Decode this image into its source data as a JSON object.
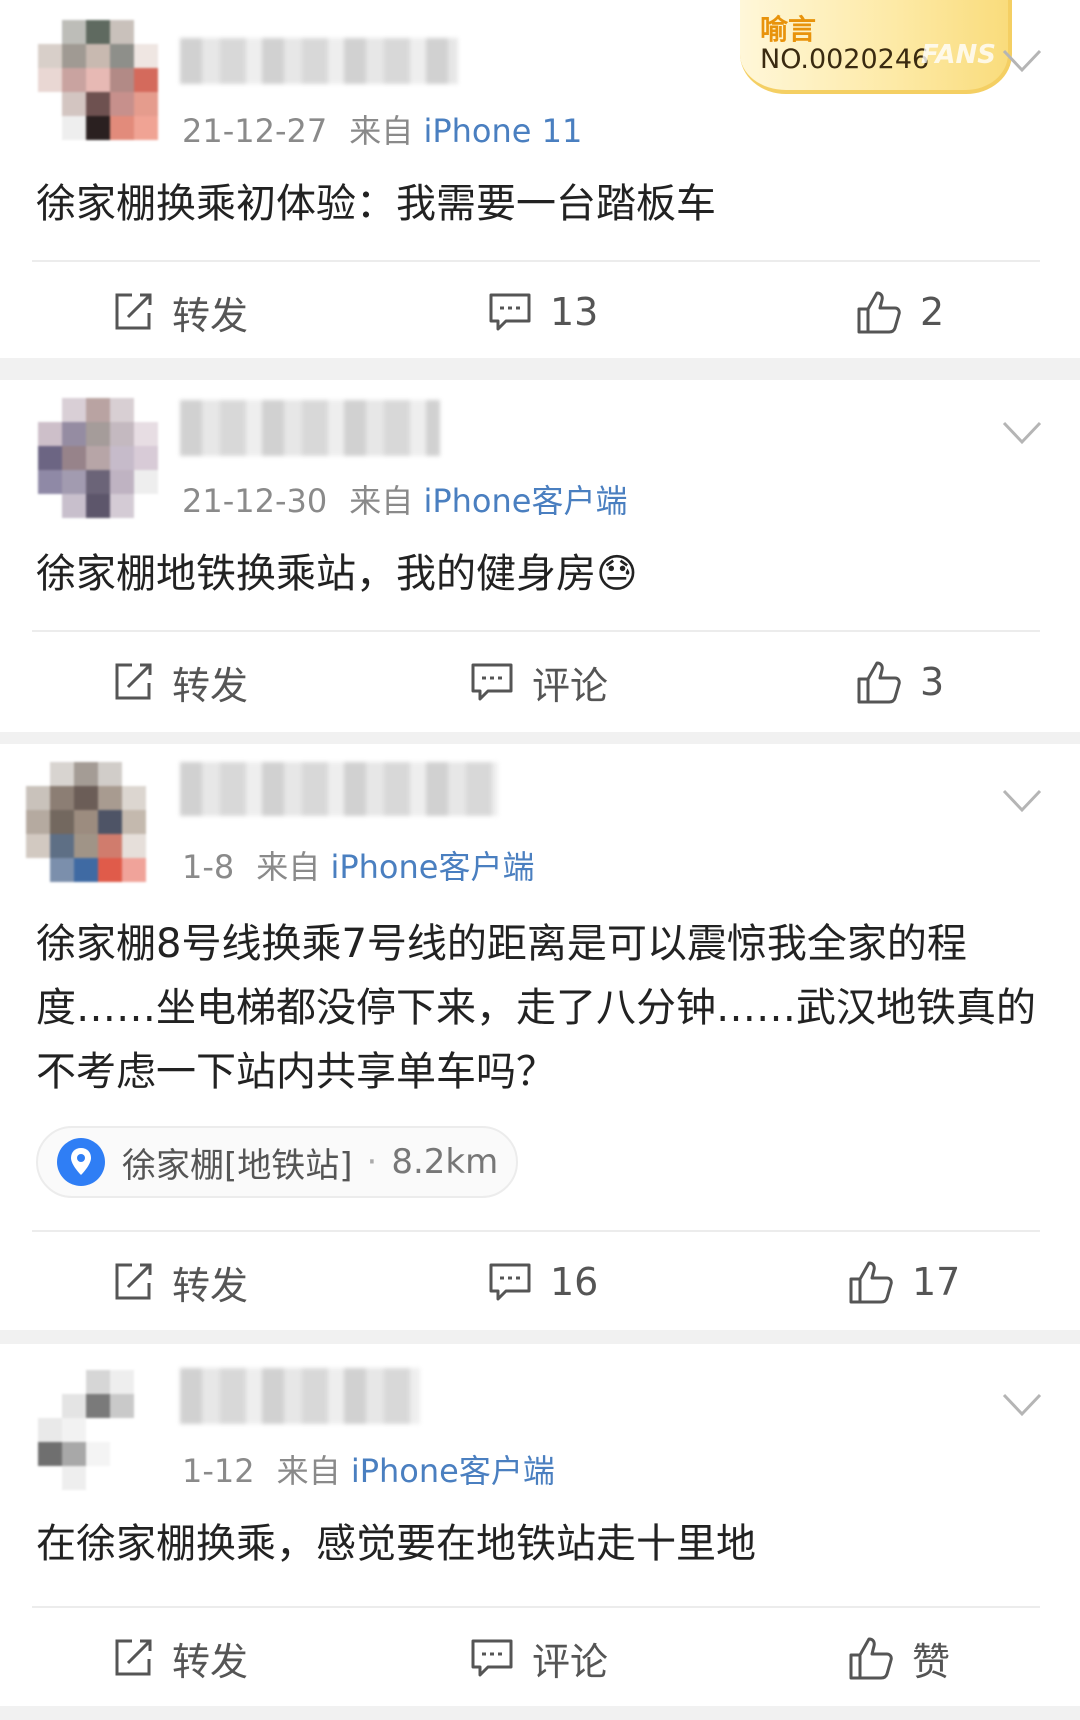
{
  "posts": [
    {
      "date": "21-12-27",
      "source_prefix": "来自",
      "source": "iPhone 11",
      "text": "徐家棚换乘初体验：我需要一台踏板车",
      "badge": {
        "title": "喻言",
        "number": "NO.0020246",
        "fans": "FANS"
      },
      "actions": {
        "repost": "转发",
        "comment": "13",
        "like": "2"
      }
    },
    {
      "date": "21-12-30",
      "source_prefix": "来自",
      "source": "iPhone客户端",
      "text": "徐家棚地铁换乘站，我的健身房😓",
      "actions": {
        "repost": "转发",
        "comment": "评论",
        "like": "3"
      }
    },
    {
      "date": "1-8",
      "source_prefix": "来自",
      "source": "iPhone客户端",
      "text": "徐家棚8号线换乘7号线的距离是可以震惊我全家的程度……坐电梯都没停下来，走了八分钟……武汉地铁真的不考虑一下站内共享单车吗？",
      "location": {
        "name": "徐家棚[地铁站]",
        "sep": "·",
        "distance": "8.2km"
      },
      "actions": {
        "repost": "转发",
        "comment": "16",
        "like": "17"
      }
    },
    {
      "date": "1-12",
      "source_prefix": "来自",
      "source": "iPhone客户端",
      "text": "在徐家棚换乘，感觉要在地铁站走十里地",
      "actions": {
        "repost": "转发",
        "comment": "评论",
        "like": "赞"
      }
    }
  ],
  "colors": {
    "link": "#4a7fc0",
    "badge": "#e8930c",
    "pin": "#2f7ef5"
  }
}
